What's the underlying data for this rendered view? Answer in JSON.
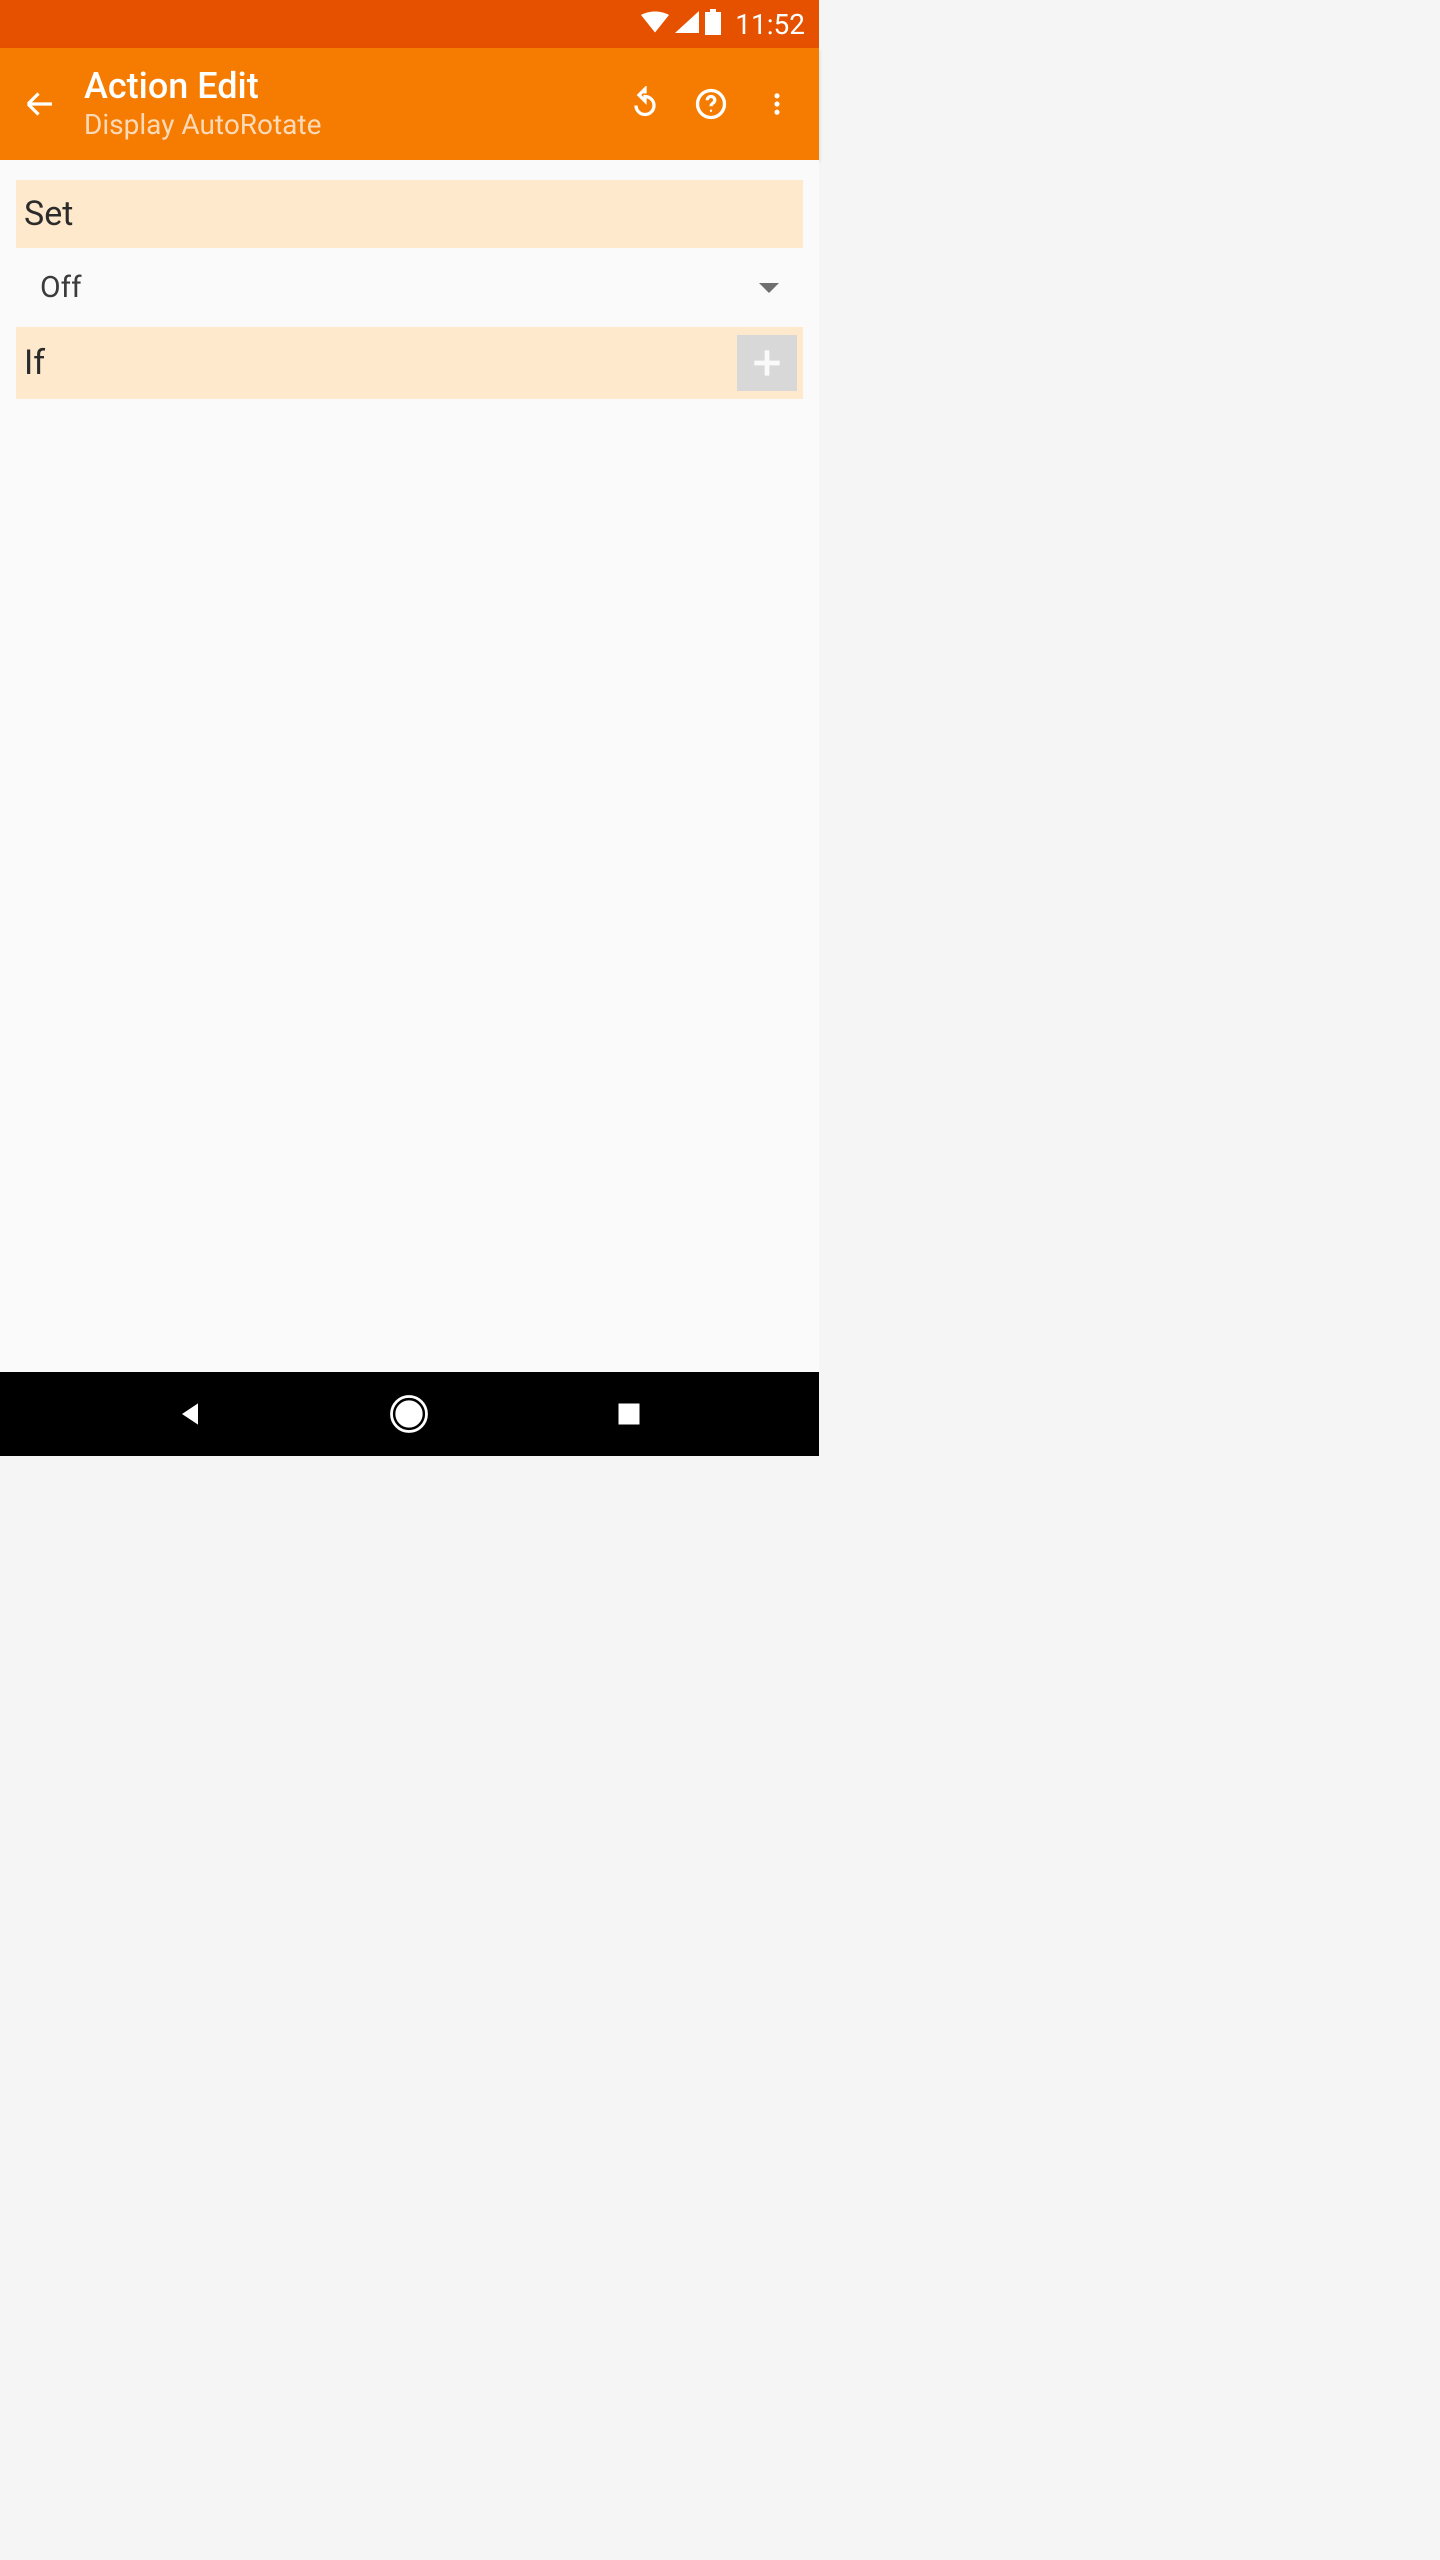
{
  "status": {
    "time": "11:52"
  },
  "appbar": {
    "title": "Action Edit",
    "subtitle": "Display AutoRotate"
  },
  "sections": {
    "set": {
      "label": "Set",
      "selected": "Off"
    },
    "if": {
      "label": "If"
    }
  }
}
